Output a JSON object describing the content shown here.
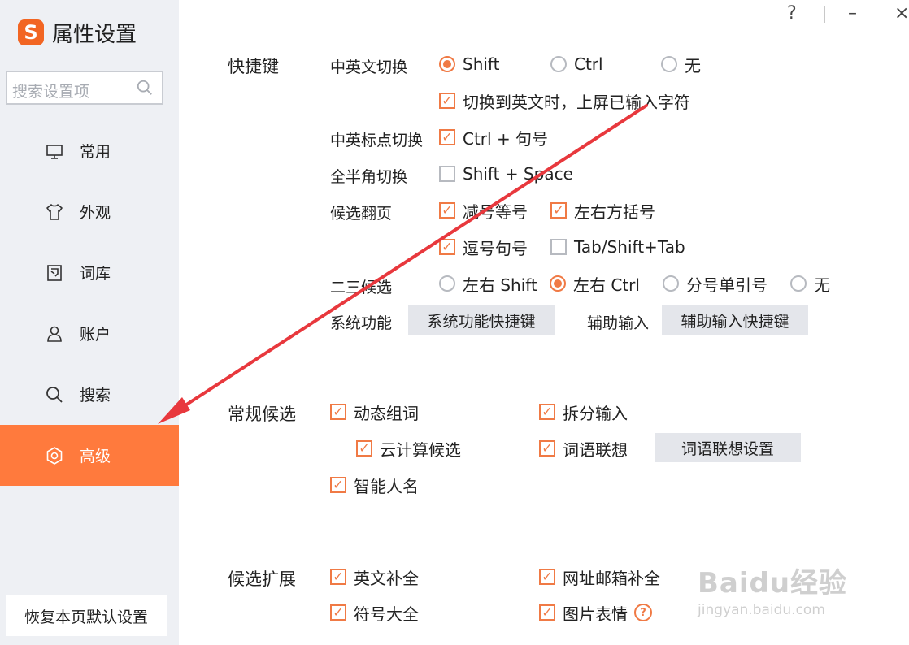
{
  "window": {
    "title": "属性设置",
    "help": "?",
    "minimize": "–",
    "close": "×"
  },
  "sidebar": {
    "logo": "S",
    "search_placeholder": "搜索设置项",
    "items": [
      {
        "label": "常用",
        "icon": "monitor-icon"
      },
      {
        "label": "外观",
        "icon": "shirt-icon"
      },
      {
        "label": "词库",
        "icon": "book-icon"
      },
      {
        "label": "账户",
        "icon": "user-icon"
      },
      {
        "label": "搜索",
        "icon": "search-icon"
      },
      {
        "label": "高级",
        "icon": "gear-icon",
        "active": true
      }
    ],
    "restore": "恢复本页默认设置"
  },
  "hotkeys": {
    "title": "快捷键",
    "cn_en": {
      "label": "中英文切换",
      "opt1": "Shift",
      "opt2": "Ctrl",
      "opt3": "无",
      "sub": "切换到英文时，上屏已输入字符"
    },
    "punct": {
      "label": "中英标点切换",
      "opt": "Ctrl + 句号"
    },
    "width": {
      "label": "全半角切换",
      "opt": "Shift + Space"
    },
    "page": {
      "label": "候选翻页",
      "opt1": "减号等号",
      "opt2": "左右方括号",
      "opt3": "逗号句号",
      "opt4": "Tab/Shift+Tab"
    },
    "cand23": {
      "label": "二三候选",
      "opt1": "左右 Shift",
      "opt2": "左右 Ctrl",
      "opt3": "分号单引号",
      "opt4": "无"
    },
    "sys": {
      "label": "系统功能",
      "button": "系统功能快捷键"
    },
    "assist": {
      "label": "辅助输入",
      "button": "辅助输入快捷键"
    }
  },
  "general": {
    "title": "常规候选",
    "dynamic": "动态组词",
    "split": "拆分输入",
    "cloud": "云计算候选",
    "assoc": "词语联想",
    "assoc_button": "词语联想设置",
    "names": "智能人名"
  },
  "extend": {
    "title": "候选扩展",
    "english": "英文补全",
    "url": "网址邮箱补全",
    "symbols": "符号大全",
    "emoji": "图片表情",
    "help": "?"
  },
  "watermark": {
    "line1": "Baidu经验",
    "line2": "jingyan.baidu.com"
  },
  "colors": {
    "accent": "#ff7a3d",
    "check": "#f07a45",
    "arrow": "#e8383d",
    "sidebar_bg": "#eef0f4"
  }
}
